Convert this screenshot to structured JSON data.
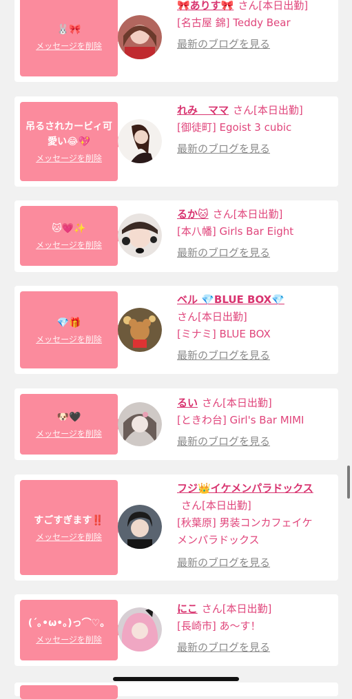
{
  "delete_label": "メッセージを削除",
  "blog_label": "最新のブログを見る",
  "entries": [
    {
      "message": "🐰🎀",
      "name": "🎀ありす🎀",
      "status": "さん[本日出勤]",
      "shop": "[名古屋 錦] Teddy Bear"
    },
    {
      "message": "吊るされカービィ可愛い😂💖",
      "name": "れみ　ママ",
      "status": "さん[本日出勤]",
      "shop": "[御徒町] Egoist 3 cubic"
    },
    {
      "message": "🐱💗✨",
      "name": "るか🐱",
      "status": "さん[本日出勤]",
      "shop": "[本八幡] Girls Bar Eight"
    },
    {
      "message": "💎🎁",
      "name": "ベル 💎BLUE BOX💎",
      "status": "さん[本日出勤]",
      "shop": "[ミナミ] BLUE BOX"
    },
    {
      "message": "🐶🖤",
      "name": "るい",
      "status": "さん[本日出勤]",
      "shop": "[ときわ台] Girl's Bar MIMI"
    },
    {
      "message": "すごすぎます‼️",
      "name": "フジ👑イケメンパラドックス",
      "status": "さん[本日出勤]",
      "shop": "[秋葉原] 男装コンカフェイケメンパラドックス"
    },
    {
      "message": "(´｡•ω•｡)っ⌒♡。",
      "name": "にこ",
      "status": "さん[本日出勤]",
      "shop": "[長崎市] あ〜す！"
    }
  ]
}
